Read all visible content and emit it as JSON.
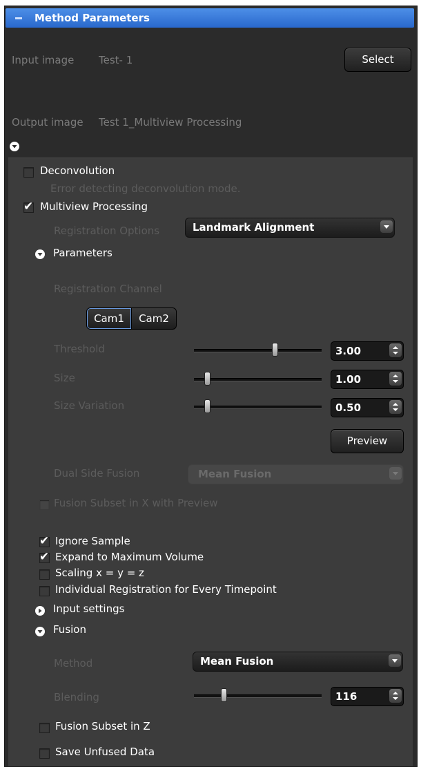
{
  "panel": {
    "title": "Method Parameters"
  },
  "io": {
    "input_label": "Input image",
    "input_value": "Test- 1",
    "select_button": "Select",
    "output_label": "Output image",
    "output_value": "Test  1_Multiview Processing"
  },
  "deconvolution": {
    "label": "Deconvolution",
    "checked": false,
    "error": "Error detecting deconvolution mode."
  },
  "multiview": {
    "label": "Multiview Processing",
    "checked": true,
    "registration_options_label": "Registration Options",
    "registration_options_value": "Landmark Alignment"
  },
  "parameters": {
    "header": "Parameters",
    "registration_channel_label": "Registration Channel",
    "channels": [
      "Cam1",
      "Cam2"
    ],
    "selected_channel": "Cam1",
    "threshold": {
      "label": "Threshold",
      "value": "3.00",
      "fraction": 0.63
    },
    "size": {
      "label": "Size",
      "value": "1.00",
      "fraction": 0.1
    },
    "size_variation": {
      "label": "Size Variation",
      "value": "0.50",
      "fraction": 0.1
    },
    "preview_button": "Preview",
    "dual_side_fusion_label": "Dual Side Fusion",
    "dual_side_fusion_value": "Mean Fusion",
    "fusion_subset_x_label": "Fusion Subset in X with Preview"
  },
  "options": {
    "ignore_sample": {
      "label": "Ignore Sample",
      "checked": true
    },
    "expand_volume": {
      "label": "Expand to Maximum Volume",
      "checked": true
    },
    "scaling": {
      "label": "Scaling x = y = z",
      "checked": false
    },
    "individual_registration": {
      "label": "Individual Registration for Every Timepoint",
      "checked": false
    }
  },
  "input_settings": {
    "header": "Input settings"
  },
  "fusion": {
    "header": "Fusion",
    "method_label": "Method",
    "method_value": "Mean Fusion",
    "blending_label": "Blending",
    "blending_value": "116",
    "blending_fraction": 0.23,
    "subset_z_label": "Fusion Subset in Z",
    "save_unfused_label": "Save Unfused Data"
  },
  "colors": {
    "title_bar": "#3b7ddb",
    "panel": "#2b2b2b",
    "inner_panel": "#3c3c3c"
  }
}
